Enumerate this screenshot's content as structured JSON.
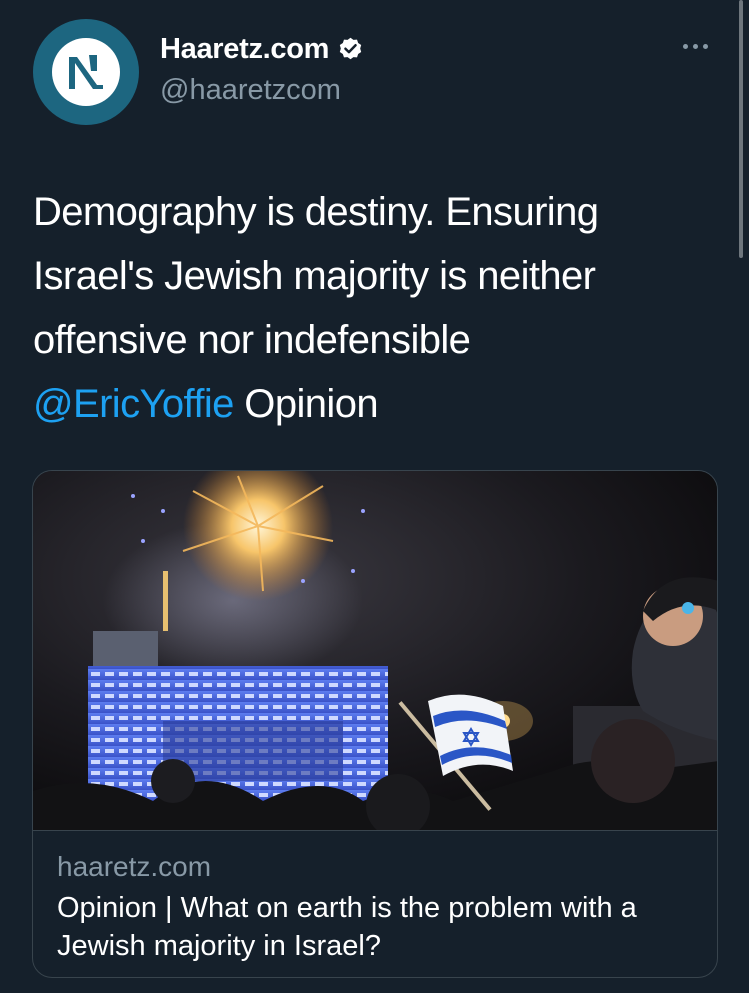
{
  "tweet": {
    "display_name": "Haaretz.com",
    "handle": "@haaretzcom",
    "text_main": "Demography is destiny. Ensuring Israel's Jewish majority is neither offensive nor indefensible",
    "mention": "@EricYoffie",
    "text_suffix": " Opinion"
  },
  "card": {
    "domain": "haaretz.com",
    "title": "Opinion | What on earth is the problem with a Jewish majority in Israel?"
  },
  "icons": {
    "avatar": "haaretz-logo-icon",
    "verified": "verified-badge-icon",
    "more": "more-options-icon"
  },
  "colors": {
    "background": "#15202b",
    "secondary_text": "#8899a6",
    "link": "#1da1f2",
    "avatar_ring": "#1d6680"
  }
}
